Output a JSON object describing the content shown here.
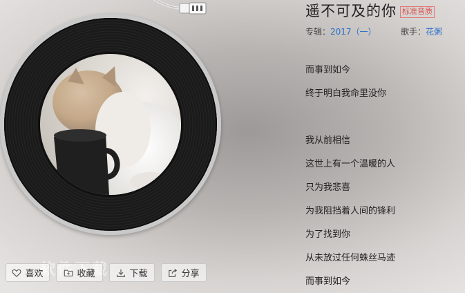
{
  "song": {
    "title": "遥不可及的你",
    "quality_badge": "标准音质",
    "album_label": "专辑：",
    "album": "2017（一）",
    "singer_label": "歌手：",
    "singer": "花粥"
  },
  "lyrics": [
    "而事到如今",
    "终于明白我命里没你",
    "",
    "我从前相信",
    "这世上有一个温暖的人",
    "只为我悲喜",
    "为我阻挡着人间的锋利",
    "为了找到你",
    "从未放过任何蛛丝马迹",
    "而事到如今"
  ],
  "actions": {
    "like": {
      "label": "喜欢",
      "icon": "heart-icon"
    },
    "favorite": {
      "label": "收藏",
      "icon": "folder-plus-icon"
    },
    "download": {
      "label": "下载",
      "icon": "download-icon"
    },
    "share": {
      "label": "分享",
      "icon": "share-icon"
    }
  },
  "watermark": "软件下载",
  "colors": {
    "link": "#2a6fc9",
    "badge": "#d9534f"
  }
}
